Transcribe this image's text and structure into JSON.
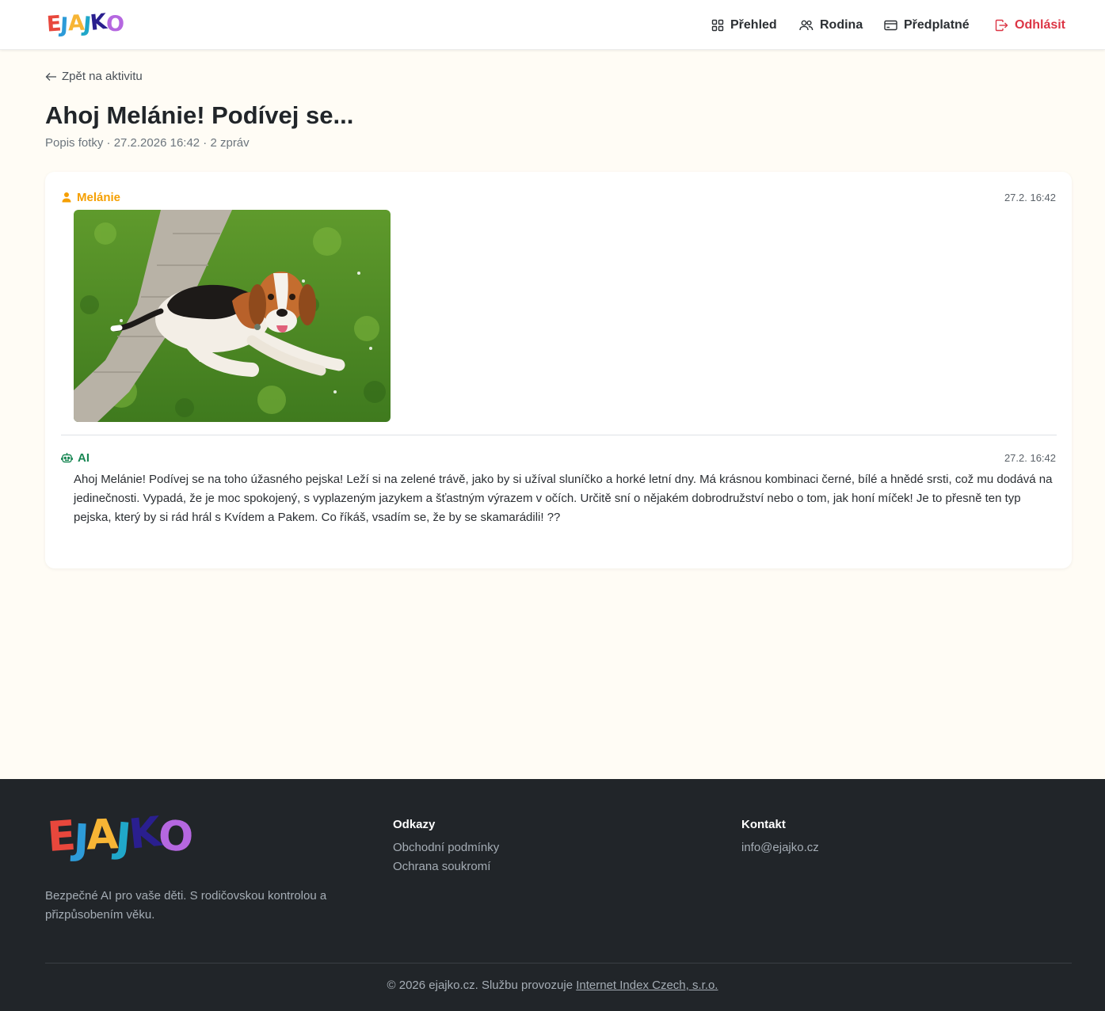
{
  "brand": {
    "letters": [
      {
        "ch": "E",
        "color": "#e8473c"
      },
      {
        "ch": "J",
        "color": "#2d9bd8"
      },
      {
        "ch": "A",
        "color": "#f7b535"
      },
      {
        "ch": "J",
        "color": "#20a7c9"
      },
      {
        "ch": "K",
        "color": "#2a1f8f"
      },
      {
        "ch": "O",
        "color": "#b567e0"
      }
    ]
  },
  "nav": {
    "overview": "Přehled",
    "family": "Rodina",
    "subscription": "Předplatné",
    "logout": "Odhlásit"
  },
  "colors": {
    "user_accent": "#f59f00",
    "ai_accent": "#198754",
    "logout": "#dc3545"
  },
  "page": {
    "back_label": "Zpět na aktivitu",
    "title": "Ahoj Melánie! Podívej se...",
    "meta": "Popis fotky · 27.2.2026 16:42 · 2 zpráv"
  },
  "messages": [
    {
      "author": "Melánie",
      "role": "user",
      "time": "27.2. 16:42",
      "icon": "person-icon",
      "image": "beagle-photo"
    },
    {
      "author": "AI",
      "role": "ai",
      "time": "27.2. 16:42",
      "icon": "robot-icon",
      "text": "Ahoj Melánie! Podívej se na toho úžasného pejska! Leží si na zelené trávě, jako by si užíval sluníčko a horké letní dny. Má krásnou kombinaci černé, bílé a hnědé srsti, což mu dodává na jedinečnosti. Vypadá, že je moc spokojený, s vyplazeným jazykem a šťastným výrazem v očích. Určitě sní o nějakém dobrodružství nebo o tom, jak honí míček! Je to přesně ten typ pejska, který by si rád hrál s Kvídem a Pakem. Co říkáš, vsadím se, že by se skamarádili! ??"
    }
  ],
  "footer": {
    "tagline": "Bezpečné AI pro vaše děti. S rodičovskou kontrolou a přizpůsobením věku.",
    "links_heading": "Odkazy",
    "links": [
      "Obchodní podmínky",
      "Ochrana soukromí"
    ],
    "contact_heading": "Kontakt",
    "email": "info@ejajko.cz",
    "copyright_prefix": "© 2026 ejajko.cz. Službu provozuje ",
    "operator": "Internet Index Czech, s.r.o."
  }
}
